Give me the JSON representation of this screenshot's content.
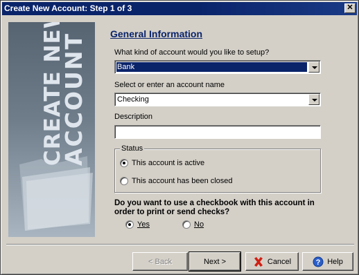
{
  "window": {
    "title": "Create New Account: Step 1 of 3",
    "close_glyph": "✕"
  },
  "banner": {
    "line1": "CREATE NEW",
    "line2": "ACCOUNT"
  },
  "general": {
    "title": "General Information",
    "kind_label": "What kind of account would you like to setup?",
    "kind_value": "Bank",
    "name_label": "Select or enter an account name",
    "name_value": "Checking",
    "description_label": "Description",
    "description_value": ""
  },
  "status": {
    "title": "Status",
    "active_label": "This account is active",
    "closed_label": "This account has been closed",
    "selected": "active"
  },
  "checkbook": {
    "question": "Do you want to use a checkbook with this account in order to print or send checks?",
    "yes_label": "Yes",
    "no_label": "No",
    "selected": "yes"
  },
  "buttons": {
    "back": "< Back",
    "next": "Next >",
    "cancel": "Cancel",
    "help": "Help"
  },
  "colors": {
    "title_bar": "#0a246a",
    "accent_link": "#0a246a",
    "cancel_icon": "#d11f12",
    "help_icon": "#2a5fc8"
  },
  "icons": {
    "cancel": "red-x-icon",
    "help": "help-question-icon",
    "banner": "folder-icon"
  }
}
